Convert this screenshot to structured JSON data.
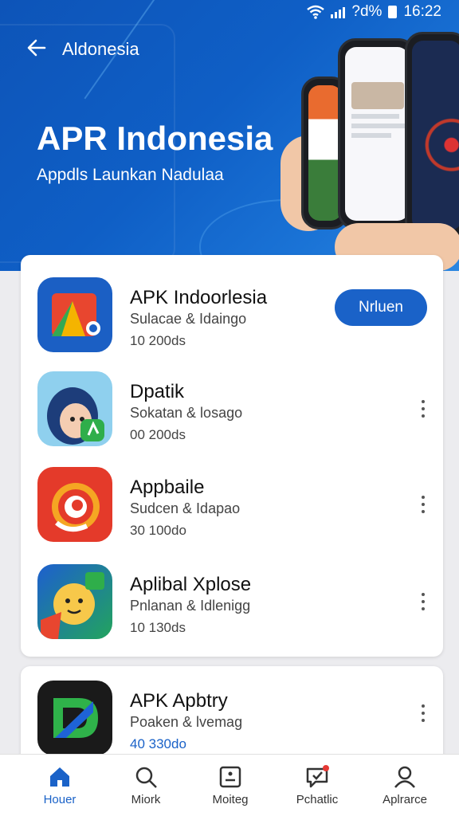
{
  "status_bar": {
    "signal_label": "?",
    "battery_text": "?d%",
    "time": "16:22"
  },
  "header": {
    "back_label": "←",
    "breadcrumb": "Aldonesia"
  },
  "hero": {
    "title": "APR Indonesia",
    "subtitle": "Appdls Launkan Nadulaa"
  },
  "apps": [
    {
      "name": "APK Indoorlesia",
      "subtitle": "Sulacae & Idaingo",
      "downloads": "10 200ds",
      "action": "Nrluen",
      "icon": "map-app-icon"
    },
    {
      "name": "Dpatik",
      "subtitle": "Sokatan & losago",
      "downloads": "00 200ds",
      "icon": "chat-avatar-app-icon"
    },
    {
      "name": "Appbaile",
      "subtitle": "Sudcen & Idapao",
      "downloads": "30 100do",
      "icon": "swirl-app-icon"
    },
    {
      "name": "Aplibal Xplose",
      "subtitle": "Pnlanan & Idlenigg",
      "downloads": "10 130ds",
      "icon": "smiley-app-icon"
    },
    {
      "name": "APK Apbtry",
      "subtitle": "Poaken & lvemag",
      "downloads": "40 330do",
      "icon": "letter-d-app-icon"
    }
  ],
  "nav": [
    {
      "label": "Houer",
      "icon": "home-icon",
      "active": true
    },
    {
      "label": "Miork",
      "icon": "search-icon"
    },
    {
      "label": "Moiteg",
      "icon": "document-icon"
    },
    {
      "label": "Pchatlic",
      "icon": "chat-icon"
    },
    {
      "label": "Aplrarce",
      "icon": "person-icon"
    }
  ],
  "colors": {
    "accent": "#1a62c8",
    "hero": "#0f5fc6"
  }
}
